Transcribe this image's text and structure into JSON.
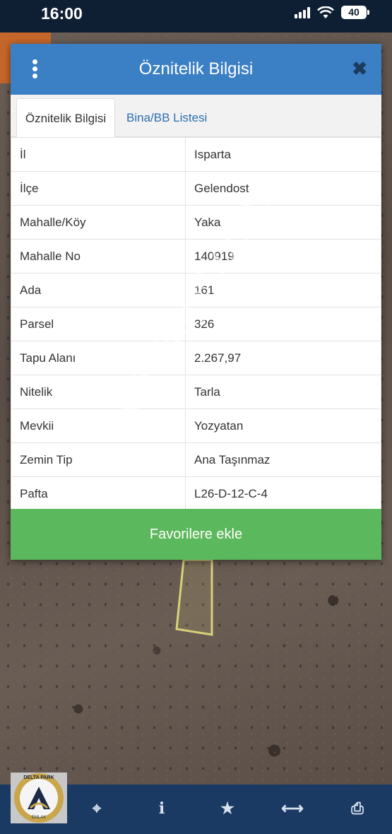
{
  "status_bar": {
    "time": "16:00",
    "battery": "40"
  },
  "dialog": {
    "title": "Öznitelik Bilgisi",
    "tabs": [
      {
        "label": "Öznitelik Bilgisi",
        "active": true
      },
      {
        "label": "Bina/BB Listesi",
        "active": false
      }
    ],
    "rows": [
      {
        "key": "İl",
        "value": "Isparta"
      },
      {
        "key": "İlçe",
        "value": "Gelendost"
      },
      {
        "key": "Mahalle/Köy",
        "value": "Yaka"
      },
      {
        "key": "Mahalle No",
        "value": "140919"
      },
      {
        "key": "Ada",
        "value": "161"
      },
      {
        "key": "Parsel",
        "value": "326"
      },
      {
        "key": "Tapu Alanı",
        "value": "2.267,97"
      },
      {
        "key": "Nitelik",
        "value": "Tarla"
      },
      {
        "key": "Mevkii",
        "value": "Yozyatan"
      },
      {
        "key": "Zemin Tip",
        "value": "Ana Taşınmaz"
      },
      {
        "key": "Pafta",
        "value": "L26-D-12-C-4"
      }
    ],
    "favorite_button": "Favorilere ekle"
  },
  "watermark": "emlakjet.com",
  "logo": {
    "top_text": "DELTA PARK",
    "bottom_text": "EMLAK"
  },
  "toolbar": {
    "icons": [
      "locate-icon",
      "info-icon",
      "star-icon",
      "measure-icon",
      "print-icon"
    ]
  },
  "colors": {
    "header": "#3b7fc4",
    "favorite_button": "#5cb85c",
    "toolbar": "#1a3a63",
    "tab_link": "#2c6fb0"
  }
}
